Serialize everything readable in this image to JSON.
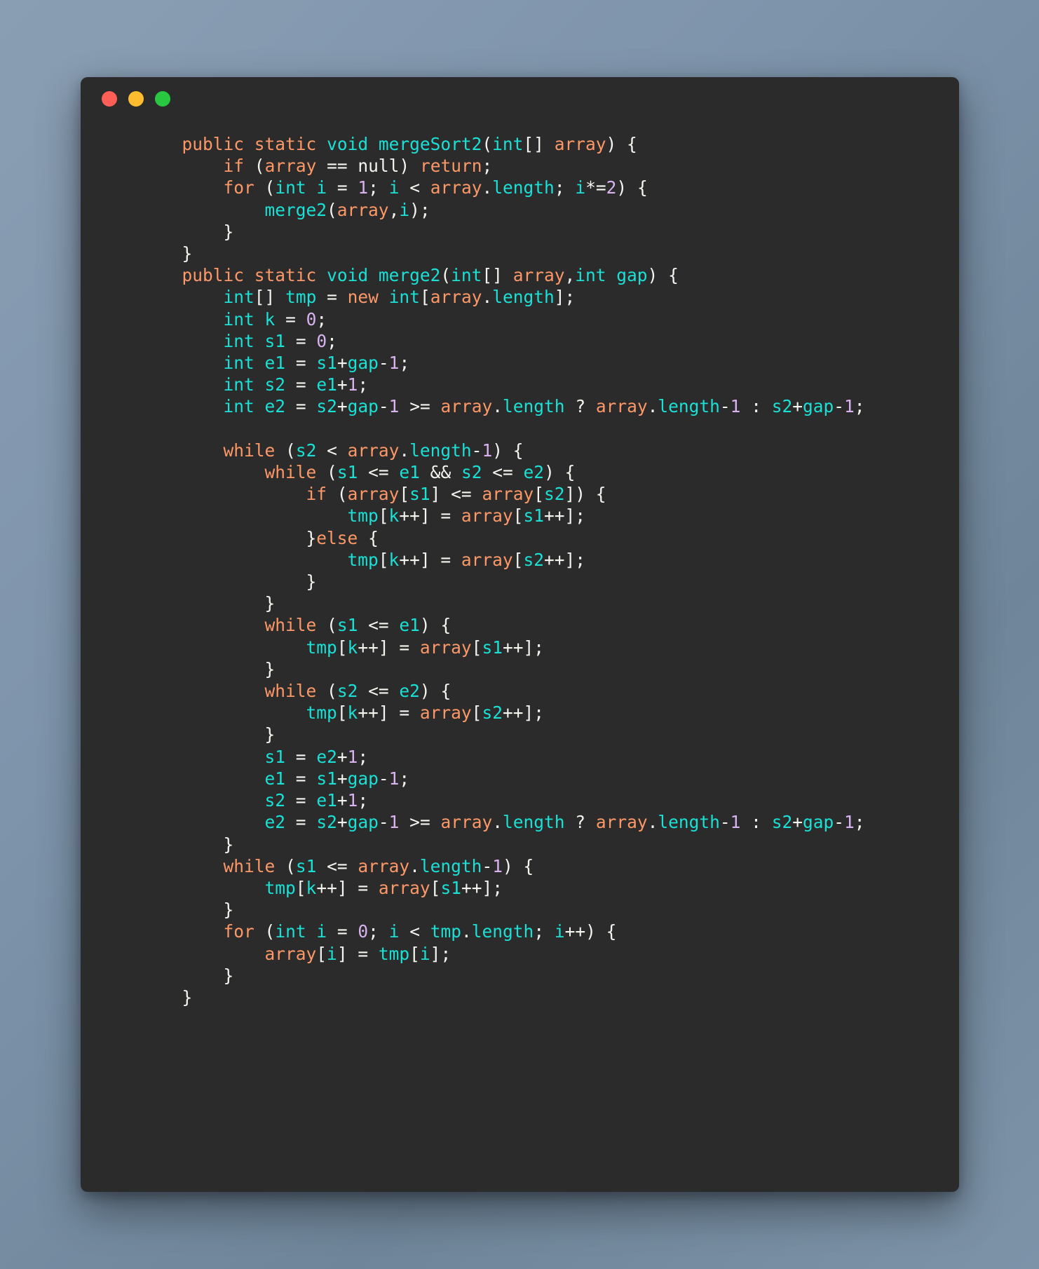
{
  "window": {
    "title_bar_buttons": [
      {
        "name": "close-button",
        "color": "#ff5f57",
        "label": ""
      },
      {
        "name": "minimize-button",
        "color": "#febc2e",
        "label": ""
      },
      {
        "name": "maximize-button",
        "color": "#28c840",
        "label": ""
      }
    ],
    "background_color": "#2b2b2b",
    "page_background_color": "#7e94ab"
  },
  "theme": {
    "keyword_color": "#fc9867",
    "type_color": "#1ae0d6",
    "number_color": "#d9b3ef",
    "punctuation_color": "#f5f5f0",
    "text_color": "#f8f8f2"
  },
  "code": {
    "language": "Java",
    "lines": [
      "    public static void mergeSort2(int[] array) {",
      "        if (array == null) return;",
      "        for (int i = 1; i < array.length; i*=2) {",
      "            merge2(array,i);",
      "        }",
      "    }",
      "    public static void merge2(int[] array,int gap) {",
      "        int[] tmp = new int[array.length];",
      "        int k = 0;",
      "        int s1 = 0;",
      "        int e1 = s1+gap-1;",
      "        int s2 = e1+1;",
      "        int e2 = s2+gap-1 >= array.length ? array.length-1 : s2+gap-1;",
      "",
      "        while (s2 < array.length-1) {",
      "            while (s1 <= e1 && s2 <= e2) {",
      "                if (array[s1] <= array[s2]) {",
      "                    tmp[k++] = array[s1++];",
      "                }else {",
      "                    tmp[k++] = array[s2++];",
      "                }",
      "            }",
      "            while (s1 <= e1) {",
      "                tmp[k++] = array[s1++];",
      "            }",
      "            while (s2 <= e2) {",
      "                tmp[k++] = array[s2++];",
      "            }",
      "            s1 = e2+1;",
      "            e1 = s1+gap-1;",
      "            s2 = e1+1;",
      "            e2 = s2+gap-1 >= array.length ? array.length-1 : s2+gap-1;",
      "        }",
      "        while (s1 <= array.length-1) {",
      "            tmp[k++] = array[s1++];",
      "        }",
      "        for (int i = 0; i < tmp.length; i++) {",
      "            array[i] = tmp[i];",
      "        }",
      "    }"
    ]
  }
}
